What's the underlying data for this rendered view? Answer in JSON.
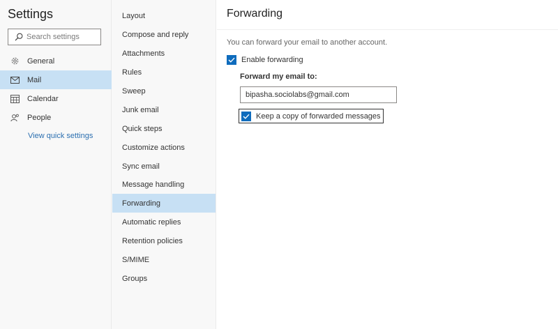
{
  "settings": {
    "title": "Settings",
    "search_placeholder": "Search settings"
  },
  "nav": {
    "items": [
      {
        "label": "General",
        "icon": "gear-icon"
      },
      {
        "label": "Mail",
        "icon": "mail-icon",
        "active": true
      },
      {
        "label": "Calendar",
        "icon": "calendar-icon"
      },
      {
        "label": "People",
        "icon": "people-icon"
      }
    ],
    "quick_settings_link": "View quick settings"
  },
  "mail_subnav": {
    "items": [
      "Layout",
      "Compose and reply",
      "Attachments",
      "Rules",
      "Sweep",
      "Junk email",
      "Quick steps",
      "Customize actions",
      "Sync email",
      "Message handling",
      "Forwarding",
      "Automatic replies",
      "Retention policies",
      "S/MIME",
      "Groups"
    ],
    "active": "Forwarding"
  },
  "forwarding": {
    "title": "Forwarding",
    "description": "You can forward your email to another account.",
    "enable_label": "Enable forwarding",
    "enable_checked": true,
    "forward_to_label": "Forward my email to:",
    "forward_to_value": "bipasha.sociolabs@gmail.com",
    "keep_copy_label": "Keep a copy of forwarded messages",
    "keep_copy_checked": true
  },
  "colors": {
    "accent": "#0f6cbd",
    "selected_bg": "#c7e0f4",
    "link": "#2b6fb0"
  }
}
